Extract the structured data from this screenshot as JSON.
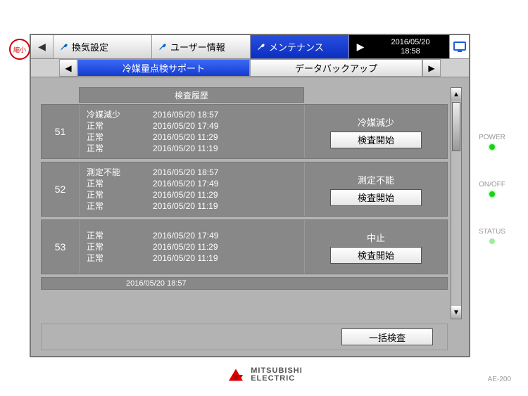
{
  "corner_label": "縮小",
  "top": {
    "tabs": [
      {
        "label": "換気設定"
      },
      {
        "label": "ユーザー情報"
      },
      {
        "label": "メンテナンス"
      }
    ],
    "active_index": 2,
    "date": "2016/05/20",
    "time": "18:58"
  },
  "sub": {
    "tabs": [
      {
        "label": "冷媒量点検サポート"
      },
      {
        "label": "データバックアップ"
      }
    ],
    "active_index": 0
  },
  "table": {
    "history_header": "検査履歴",
    "rows": [
      {
        "num": "51",
        "history": [
          {
            "status": "冷媒減少",
            "ts": "2016/05/20  18:57"
          },
          {
            "status": "正常",
            "ts": "2016/05/20  17:49"
          },
          {
            "status": "正常",
            "ts": "2016/05/20  11:29"
          },
          {
            "status": "正常",
            "ts": "2016/05/20  11:19"
          }
        ],
        "action_status": "冷媒減少",
        "action_button": "検査開始"
      },
      {
        "num": "52",
        "history": [
          {
            "status": "測定不能",
            "ts": "2016/05/20  18:57"
          },
          {
            "status": "正常",
            "ts": "2016/05/20  17:49"
          },
          {
            "status": "正常",
            "ts": "2016/05/20  11:29"
          },
          {
            "status": "正常",
            "ts": "2016/05/20  11:19"
          }
        ],
        "action_status": "測定不能",
        "action_button": "検査開始"
      },
      {
        "num": "53",
        "history": [
          {
            "status": "正常",
            "ts": "2016/05/20  17:49"
          },
          {
            "status": "正常",
            "ts": "2016/05/20  11:29"
          },
          {
            "status": "正常",
            "ts": "2016/05/20  11:19"
          }
        ],
        "action_status": "中止",
        "action_button": "検査開始"
      }
    ],
    "peek_ts": "2016/05/20  18:57"
  },
  "bottom_button": "一括検査",
  "side": {
    "power": "POWER",
    "onoff": "ON/OFF",
    "status": "STATUS"
  },
  "brand": "MITSUBISHI\nELECTRIC",
  "model": "AE-200"
}
